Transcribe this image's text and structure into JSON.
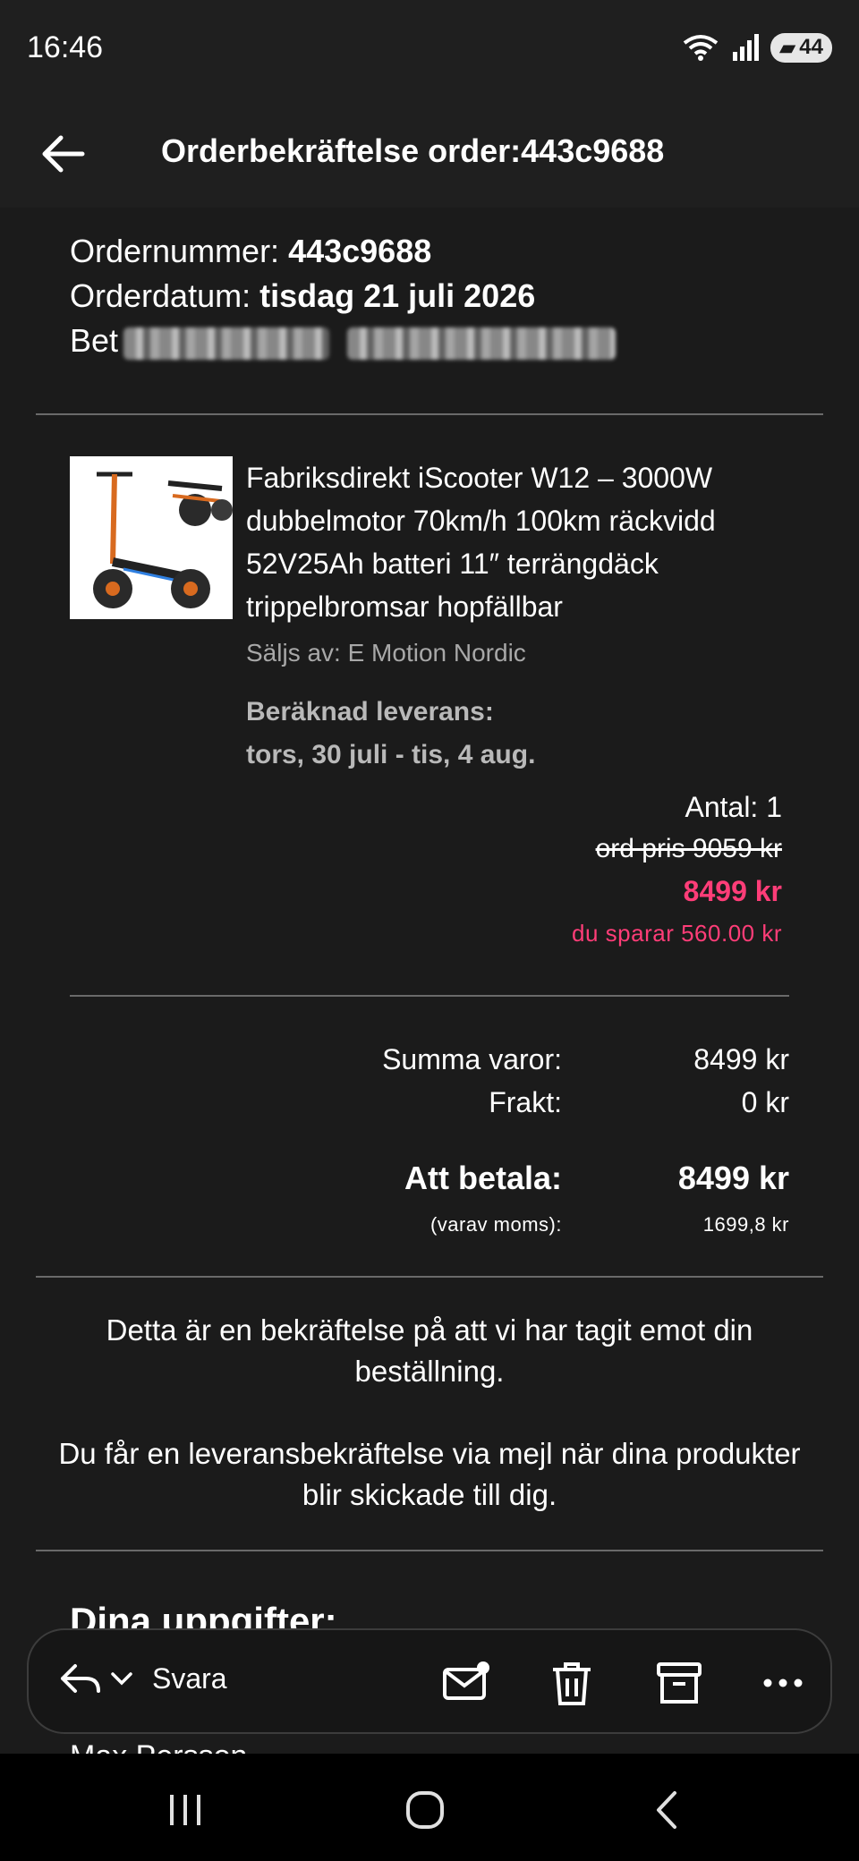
{
  "status": {
    "time": "16:46",
    "network": "6",
    "battery": "44"
  },
  "header": {
    "title": "Orderbekräftelse order:443c9688"
  },
  "order": {
    "number_label": "Ordernummer: ",
    "number": "443c9688",
    "date_label": "Orderdatum: ",
    "date": "tisdag 21 juli 2026",
    "payment_visible": "Bet"
  },
  "product": {
    "title": "Fabriksdirekt iScooter W12 – 3000W dubbelmotor 70km/h 100km räckvidd 52V25Ah batteri 11″ terrängdäck trippelbromsar hopfällbar",
    "seller": "Säljs av: E Motion Nordic",
    "delivery_label": "Beräknad leverans:",
    "delivery_dates": "tors, 30 juli - tis, 4 aug.",
    "quantity": "Antal: 1",
    "old_price": "ord pris 9059 kr",
    "price": "8499 kr",
    "savings": "du sparar 560.00 kr"
  },
  "summary": {
    "items_label": "Summa varor:",
    "items_value": "8499 kr",
    "shipping_label": "Frakt:",
    "shipping_value": "0 kr",
    "total_label": "Att betala:",
    "total_value": "8499 kr",
    "vat_label": "(varav moms):",
    "vat_value": "1699,8 kr"
  },
  "info": {
    "line1": "Detta är en bekräftelse på att vi har tagit emot din beställning.",
    "line2": "Du får en leveransbekräftelse via mejl när dina produkter blir skickade till dig."
  },
  "details": {
    "title": "Dina uppgifter:",
    "name_peek": "Max Persson"
  },
  "actions": {
    "reply_label": "Svara"
  },
  "colors": {
    "accent": "#ff3d78",
    "background": "#1b1b1b"
  }
}
